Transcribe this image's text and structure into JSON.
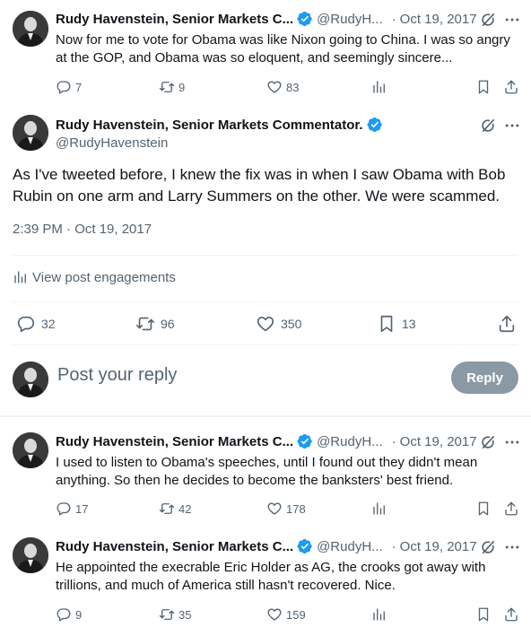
{
  "tweets_top": {
    "author_name": "Rudy Havenstein, Senior Markets C...",
    "handle": "@RudyH...",
    "dot": "·",
    "date": "Oct 19, 2017",
    "text_line1": "Now for me to vote for Obama was like Nixon going to China. I was so angry",
    "text_line2": "at the GOP, and Obama was so eloquent, and seemingly sincere...",
    "replies": "7",
    "retweets": "9",
    "likes": "83"
  },
  "main_tweet": {
    "author_name": "Rudy Havenstein, Senior Markets Commentator.",
    "handle": "@RudyHavenstein",
    "text_line1": "As I've tweeted before, I knew the fix was in when I saw Obama with Bob",
    "text_line2": "Rubin on one arm and Larry Summers on the other. We were scammed.",
    "timestamp": "2:39 PM · Oct 19, 2017",
    "engagements_label": "View post engagements",
    "replies": "32",
    "retweets": "96",
    "likes": "350",
    "bookmarks": "13"
  },
  "reply_composer": {
    "placeholder": "Post your reply",
    "button_label": "Reply"
  },
  "replies": [
    {
      "author_name": "Rudy Havenstein, Senior Markets C...",
      "handle": "@RudyH...",
      "dot": "·",
      "date": "Oct 19, 2017",
      "text_line1": "I used to listen to Obama's speeches, until I found out they didn't mean",
      "text_line2": "anything.  So then he decides to become the banksters' best friend.",
      "replies": "17",
      "retweets": "42",
      "likes": "178"
    },
    {
      "author_name": "Rudy Havenstein, Senior Markets C...",
      "handle": "@RudyH...",
      "dot": "·",
      "date": "Oct 19, 2017",
      "text_line1": "He appointed the execrable Eric Holder as AG, the crooks got away with",
      "text_line2": "trillions, and much of America still hasn't recovered. Nice.",
      "replies": "9",
      "retweets": "35",
      "likes": "159"
    }
  ],
  "colors": {
    "text_primary": "#0f1419",
    "text_secondary": "#536471",
    "verified_blue": "#1d9bf0",
    "reply_button_disabled": "#8b98a5",
    "divider": "#eff3f4"
  },
  "icons": [
    "verified-badge-icon",
    "grok-icon",
    "more-icon",
    "reply-icon",
    "retweet-icon",
    "like-icon",
    "views-icon",
    "bookmark-icon",
    "share-icon"
  ]
}
